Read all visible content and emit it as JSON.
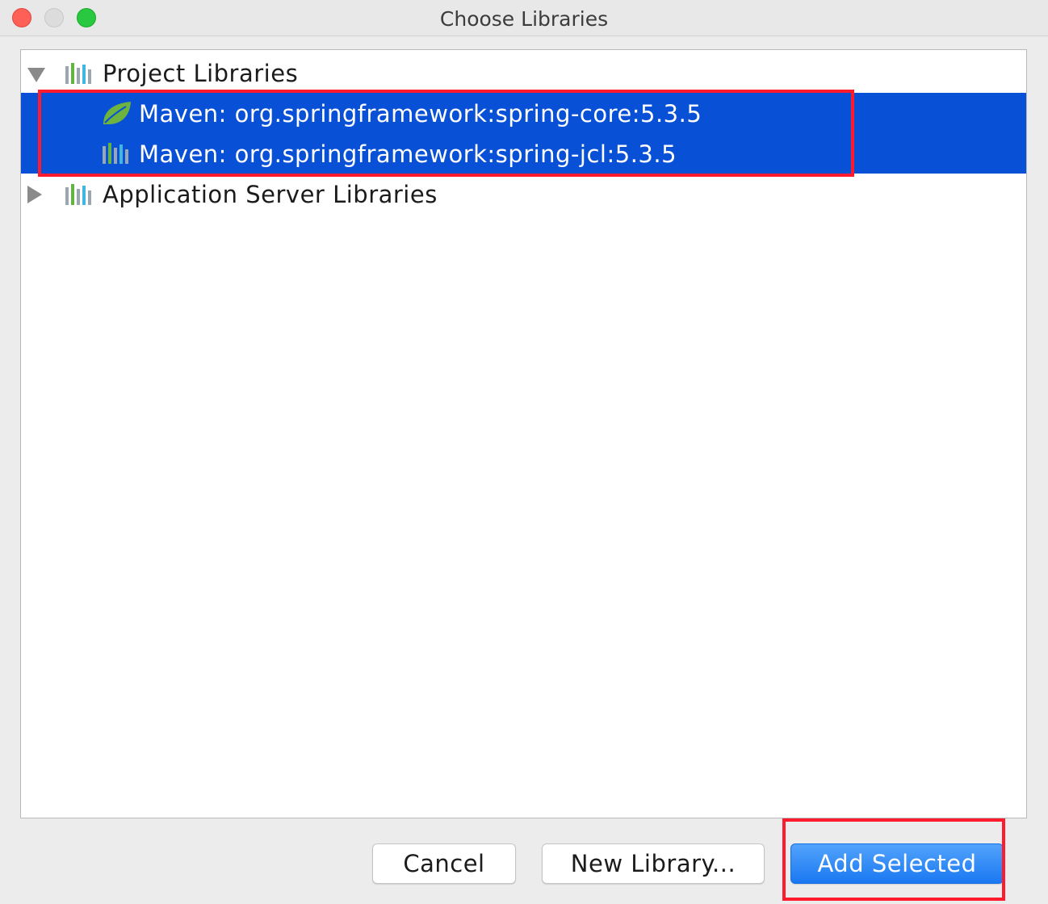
{
  "window": {
    "title": "Choose Libraries"
  },
  "tree": {
    "project_libraries": {
      "label": "Project Libraries",
      "expanded": true,
      "icon": "library-icon",
      "children": [
        {
          "label": "Maven: org.springframework:spring-core:5.3.5",
          "icon": "spring-leaf-icon",
          "selected": true
        },
        {
          "label": "Maven: org.springframework:spring-jcl:5.3.5",
          "icon": "library-icon",
          "selected": true
        }
      ]
    },
    "application_server_libraries": {
      "label": "Application Server Libraries",
      "expanded": false,
      "icon": "library-icon"
    }
  },
  "buttons": {
    "cancel": "Cancel",
    "new_library": "New Library...",
    "add_selected": "Add Selected"
  },
  "colors": {
    "selection": "#0850d6",
    "highlight": "#ff1a2e",
    "primary_button": "#1a78f2"
  }
}
